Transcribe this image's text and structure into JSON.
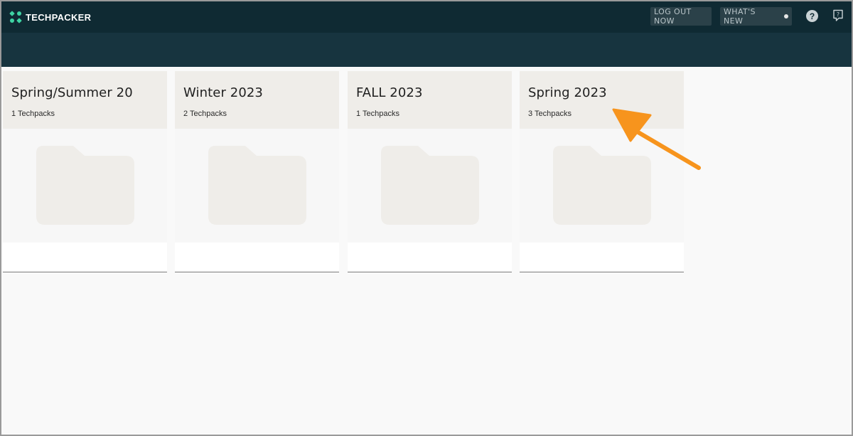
{
  "app": {
    "logo_text": "TECHPACKER"
  },
  "header": {
    "logout_label": "LOG OUT NOW",
    "whats_new_label": "WHAT'S NEW",
    "help_glyph": "?"
  },
  "folders": [
    {
      "title": "Spring/Summer 20",
      "count_label": "1 Techpacks"
    },
    {
      "title": "Winter 2023",
      "count_label": "2 Techpacks"
    },
    {
      "title": "FALL 2023",
      "count_label": "1 Techpacks"
    },
    {
      "title": "Spring 2023",
      "count_label": "3 Techpacks"
    }
  ],
  "colors": {
    "topbar": "#0f2a33",
    "subbar": "#17343f",
    "accent": "#3ed3a3",
    "annotation_arrow": "#f7941d",
    "folder_placeholder": "#efede9"
  },
  "icons": [
    "logo-icon",
    "help-icon",
    "feedback-icon",
    "folder-icon",
    "annotation-arrow-icon"
  ]
}
